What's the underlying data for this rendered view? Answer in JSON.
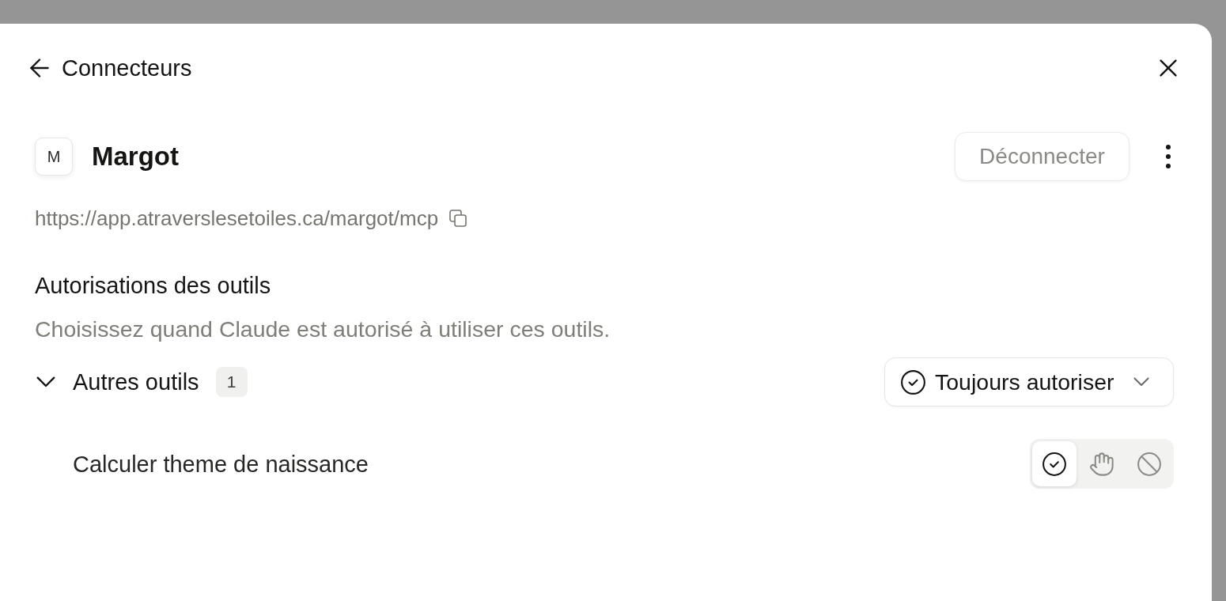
{
  "header": {
    "title": "Connecteurs"
  },
  "connector": {
    "initial": "M",
    "name": "Margot",
    "disconnect_label": "Déconnecter",
    "url": "https://app.atraverslesetoiles.ca/margot/mcp"
  },
  "permissions": {
    "title": "Autorisations des outils",
    "description": "Choisissez quand Claude est autorisé à utiliser ces outils.",
    "groups": [
      {
        "label": "Autres outils",
        "count": "1",
        "expanded": true,
        "policy": {
          "kind": "allow",
          "label": "Toujours autoriser"
        },
        "tools": [
          {
            "name": "Calculer theme de naissance",
            "options": [
              {
                "kind": "allow",
                "selected": true
              },
              {
                "kind": "ask",
                "selected": false
              },
              {
                "kind": "block",
                "selected": false
              }
            ]
          }
        ]
      }
    ]
  }
}
